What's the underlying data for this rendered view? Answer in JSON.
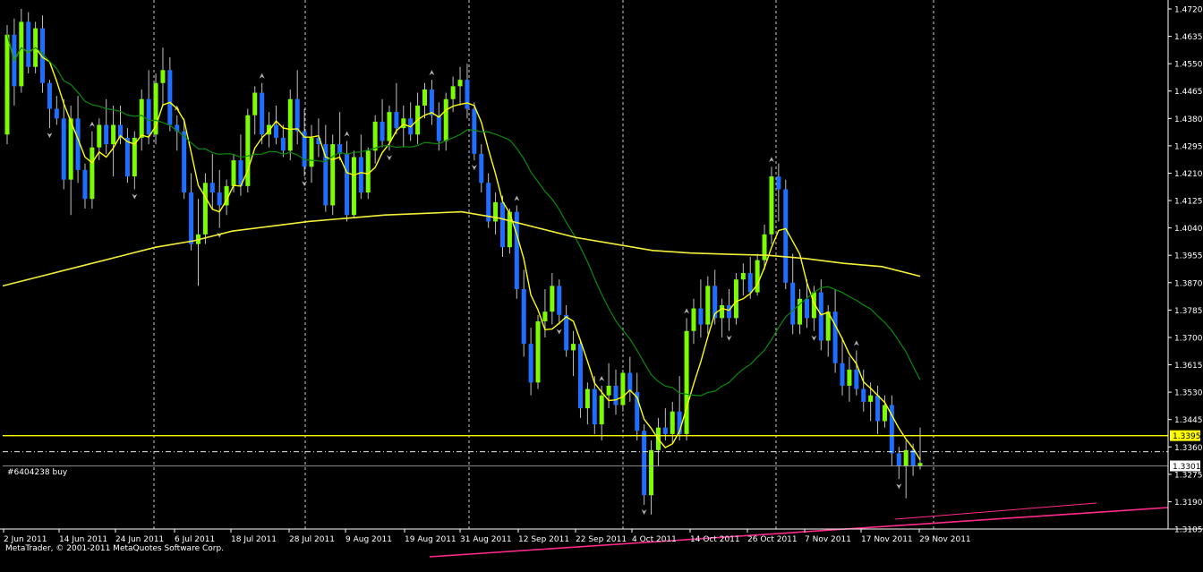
{
  "chart_data": {
    "type": "candlestick",
    "platform": "MetaTrader",
    "copyright": "MetaTrader, © 2001-2011 MetaQuotes Software Corp.",
    "colors": {
      "background": "#000000",
      "bull_candle": "#7cfc00",
      "bear_candle": "#1e6fff",
      "wick": "#c0c0c0",
      "ma_fast": "#ffff00",
      "ma_mid": "#0a8a0a",
      "ma_slow": "#f4f03a",
      "trendline": "#ff2a8a",
      "separator": "#ffffff",
      "level_line": "#ffff00",
      "order_line": "#aaaaaa"
    },
    "y_axis": {
      "min": 1.3105,
      "max": 1.472,
      "ticks": [
        "1.4720",
        "1.4635",
        "1.4550",
        "1.4465",
        "1.4380",
        "1.4295",
        "1.4210",
        "1.4125",
        "1.4040",
        "1.3955",
        "1.3870",
        "1.3785",
        "1.3700",
        "1.3615",
        "1.3530",
        "1.3445",
        "1.3360",
        "1.3275",
        "1.3190",
        "1.3105"
      ]
    },
    "x_axis": {
      "labels": [
        "2 Jun 2011",
        "14 Jun 2011",
        "24 Jun 2011",
        "6 Jul 2011",
        "18 Jul 2011",
        "28 Jul 2011",
        "9 Aug 2011",
        "19 Aug 2011",
        "31 Aug 2011",
        "12 Sep 2011",
        "22 Sep 2011",
        "4 Oct 2011",
        "14 Oct 2011",
        "26 Oct 2011",
        "7 Nov 2011",
        "17 Nov 2011",
        "29 Nov 2011"
      ]
    },
    "horizontal_levels": [
      {
        "price": 1.3395,
        "label": "1.3395",
        "style": "solid",
        "color": "#ffff00"
      },
      {
        "price": 1.3345,
        "label": "#6404238 buy",
        "style": "dashdot",
        "color": "#ffffff"
      },
      {
        "price": 1.3301,
        "label": "1.3301",
        "style": "solid",
        "color": "#aaaaaa"
      }
    ],
    "ohlc": [
      [
        1.433,
        1.467,
        1.43,
        1.464
      ],
      [
        1.464,
        1.469,
        1.442,
        1.448
      ],
      [
        1.448,
        1.472,
        1.446,
        1.468
      ],
      [
        1.468,
        1.471,
        1.452,
        1.454
      ],
      [
        1.454,
        1.468,
        1.452,
        1.466
      ],
      [
        1.466,
        1.47,
        1.446,
        1.449
      ],
      [
        1.449,
        1.45,
        1.435,
        1.441
      ],
      [
        1.441,
        1.445,
        1.436,
        1.438
      ],
      [
        1.438,
        1.444,
        1.416,
        1.419
      ],
      [
        1.419,
        1.442,
        1.408,
        1.438
      ],
      [
        1.438,
        1.445,
        1.418,
        1.422
      ],
      [
        1.422,
        1.424,
        1.41,
        1.413
      ],
      [
        1.413,
        1.434,
        1.41,
        1.429
      ],
      [
        1.429,
        1.438,
        1.425,
        1.436
      ],
      [
        1.436,
        1.444,
        1.427,
        1.43
      ],
      [
        1.43,
        1.442,
        1.42,
        1.436
      ],
      [
        1.436,
        1.442,
        1.43,
        1.432
      ],
      [
        1.432,
        1.435,
        1.418,
        1.42
      ],
      [
        1.42,
        1.434,
        1.416,
        1.432
      ],
      [
        1.432,
        1.447,
        1.428,
        1.444
      ],
      [
        1.444,
        1.453,
        1.43,
        1.433
      ],
      [
        1.433,
        1.452,
        1.43,
        1.449
      ],
      [
        1.449,
        1.46,
        1.442,
        1.453
      ],
      [
        1.453,
        1.457,
        1.434,
        1.436
      ],
      [
        1.436,
        1.439,
        1.428,
        1.434
      ],
      [
        1.434,
        1.438,
        1.413,
        1.415
      ],
      [
        1.415,
        1.421,
        1.397,
        1.399
      ],
      [
        1.399,
        1.413,
        1.386,
        1.402
      ],
      [
        1.402,
        1.421,
        1.399,
        1.418
      ],
      [
        1.418,
        1.427,
        1.41,
        1.415
      ],
      [
        1.415,
        1.422,
        1.404,
        1.411
      ],
      [
        1.411,
        1.419,
        1.408,
        1.417
      ],
      [
        1.417,
        1.427,
        1.415,
        1.425
      ],
      [
        1.425,
        1.433,
        1.414,
        1.417
      ],
      [
        1.417,
        1.441,
        1.415,
        1.439
      ],
      [
        1.439,
        1.448,
        1.433,
        1.446
      ],
      [
        1.446,
        1.449,
        1.43,
        1.433
      ],
      [
        1.433,
        1.44,
        1.429,
        1.436
      ],
      [
        1.436,
        1.442,
        1.43,
        1.432
      ],
      [
        1.432,
        1.436,
        1.426,
        1.428
      ],
      [
        1.428,
        1.447,
        1.425,
        1.444
      ],
      [
        1.444,
        1.453,
        1.43,
        1.434
      ],
      [
        1.434,
        1.441,
        1.42,
        1.423
      ],
      [
        1.423,
        1.436,
        1.418,
        1.432
      ],
      [
        1.432,
        1.438,
        1.426,
        1.43
      ],
      [
        1.43,
        1.436,
        1.409,
        1.411
      ],
      [
        1.411,
        1.433,
        1.408,
        1.43
      ],
      [
        1.43,
        1.44,
        1.425,
        1.427
      ],
      [
        1.427,
        1.431,
        1.406,
        1.408
      ],
      [
        1.408,
        1.428,
        1.407,
        1.426
      ],
      [
        1.426,
        1.433,
        1.413,
        1.415
      ],
      [
        1.415,
        1.429,
        1.413,
        1.428
      ],
      [
        1.428,
        1.439,
        1.424,
        1.437
      ],
      [
        1.437,
        1.444,
        1.429,
        1.431
      ],
      [
        1.431,
        1.442,
        1.428,
        1.44
      ],
      [
        1.44,
        1.449,
        1.433,
        1.435
      ],
      [
        1.435,
        1.442,
        1.429,
        1.438
      ],
      [
        1.438,
        1.443,
        1.431,
        1.433
      ],
      [
        1.433,
        1.446,
        1.43,
        1.442
      ],
      [
        1.442,
        1.449,
        1.438,
        1.447
      ],
      [
        1.447,
        1.45,
        1.436,
        1.439
      ],
      [
        1.439,
        1.443,
        1.428,
        1.431
      ],
      [
        1.431,
        1.446,
        1.428,
        1.444
      ],
      [
        1.444,
        1.451,
        1.44,
        1.448
      ],
      [
        1.448,
        1.454,
        1.442,
        1.45
      ],
      [
        1.45,
        1.455,
        1.438,
        1.441
      ],
      [
        1.441,
        1.443,
        1.425,
        1.427
      ],
      [
        1.427,
        1.43,
        1.415,
        1.418
      ],
      [
        1.418,
        1.421,
        1.404,
        1.406
      ],
      [
        1.406,
        1.415,
        1.402,
        1.412
      ],
      [
        1.412,
        1.414,
        1.395,
        1.398
      ],
      [
        1.398,
        1.41,
        1.396,
        1.409
      ],
      [
        1.409,
        1.411,
        1.382,
        1.385
      ],
      [
        1.385,
        1.391,
        1.364,
        1.368
      ],
      [
        1.368,
        1.373,
        1.352,
        1.356
      ],
      [
        1.356,
        1.377,
        1.354,
        1.375
      ],
      [
        1.375,
        1.385,
        1.37,
        1.378
      ],
      [
        1.378,
        1.39,
        1.374,
        1.386
      ],
      [
        1.386,
        1.388,
        1.374,
        1.377
      ],
      [
        1.377,
        1.38,
        1.364,
        1.366
      ],
      [
        1.366,
        1.372,
        1.358,
        1.368
      ],
      [
        1.368,
        1.369,
        1.345,
        1.348
      ],
      [
        1.348,
        1.356,
        1.343,
        1.354
      ],
      [
        1.354,
        1.358,
        1.34,
        1.343
      ],
      [
        1.343,
        1.355,
        1.338,
        1.352
      ],
      [
        1.352,
        1.362,
        1.348,
        1.355
      ],
      [
        1.355,
        1.36,
        1.346,
        1.349
      ],
      [
        1.349,
        1.36,
        1.347,
        1.359
      ],
      [
        1.359,
        1.364,
        1.35,
        1.353
      ],
      [
        1.353,
        1.359,
        1.338,
        1.341
      ],
      [
        1.341,
        1.343,
        1.318,
        1.321
      ],
      [
        1.321,
        1.338,
        1.315,
        1.335
      ],
      [
        1.335,
        1.345,
        1.33,
        1.342
      ],
      [
        1.342,
        1.348,
        1.338,
        1.34
      ],
      [
        1.34,
        1.35,
        1.337,
        1.347
      ],
      [
        1.347,
        1.358,
        1.338,
        1.34
      ],
      [
        1.34,
        1.376,
        1.338,
        1.372
      ],
      [
        1.372,
        1.382,
        1.368,
        1.379
      ],
      [
        1.379,
        1.388,
        1.37,
        1.374
      ],
      [
        1.374,
        1.389,
        1.371,
        1.386
      ],
      [
        1.386,
        1.391,
        1.374,
        1.376
      ],
      [
        1.376,
        1.382,
        1.37,
        1.38
      ],
      [
        1.38,
        1.385,
        1.372,
        1.376
      ],
      [
        1.376,
        1.39,
        1.374,
        1.388
      ],
      [
        1.388,
        1.393,
        1.383,
        1.39
      ],
      [
        1.39,
        1.395,
        1.382,
        1.384
      ],
      [
        1.384,
        1.396,
        1.383,
        1.394
      ],
      [
        1.394,
        1.405,
        1.391,
        1.402
      ],
      [
        1.402,
        1.423,
        1.399,
        1.42
      ],
      [
        1.42,
        1.424,
        1.406,
        1.416
      ],
      [
        1.416,
        1.419,
        1.385,
        1.387
      ],
      [
        1.387,
        1.396,
        1.371,
        1.374
      ],
      [
        1.374,
        1.385,
        1.371,
        1.382
      ],
      [
        1.382,
        1.388,
        1.373,
        1.376
      ],
      [
        1.376,
        1.386,
        1.372,
        1.384
      ],
      [
        1.384,
        1.388,
        1.366,
        1.369
      ],
      [
        1.369,
        1.38,
        1.364,
        1.378
      ],
      [
        1.378,
        1.385,
        1.359,
        1.362
      ],
      [
        1.362,
        1.37,
        1.352,
        1.355
      ],
      [
        1.355,
        1.364,
        1.35,
        1.36
      ],
      [
        1.36,
        1.366,
        1.352,
        1.354
      ],
      [
        1.354,
        1.36,
        1.347,
        1.35
      ],
      [
        1.35,
        1.356,
        1.344,
        1.352
      ],
      [
        1.352,
        1.355,
        1.34,
        1.344
      ],
      [
        1.344,
        1.352,
        1.342,
        1.349
      ],
      [
        1.349,
        1.352,
        1.33,
        1.334
      ],
      [
        1.334,
        1.336,
        1.326,
        1.33
      ],
      [
        1.33,
        1.338,
        1.32,
        1.335
      ],
      [
        1.335,
        1.337,
        1.327,
        1.33
      ],
      [
        1.33,
        1.342,
        1.329,
        1.331
      ]
    ],
    "ma_slow": [
      1.386,
      1.389,
      1.392,
      1.395,
      1.398,
      1.4,
      1.403,
      1.4045,
      1.406,
      1.407,
      1.408,
      1.4085,
      1.409,
      1.407,
      1.404,
      1.401,
      1.399,
      1.397,
      1.3962,
      1.3958,
      1.3955,
      1.3945,
      1.393,
      1.392,
      1.389
    ]
  },
  "labels": {
    "level_price": "1.3395",
    "current_price": "1.3301",
    "order": "#6404238 buy"
  }
}
